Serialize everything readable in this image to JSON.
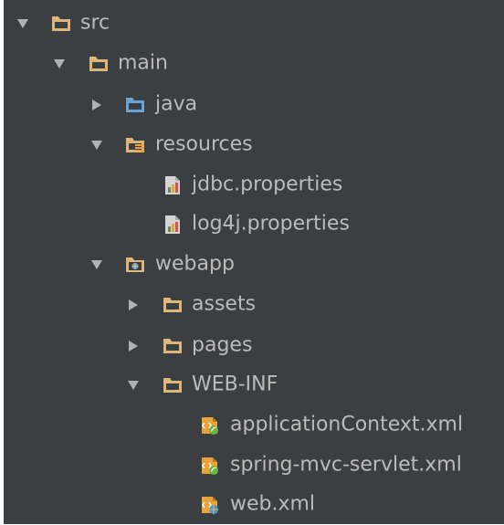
{
  "tree": {
    "items": [
      {
        "label": "src",
        "depth": 0,
        "state": "expanded",
        "icon": "folder-icon"
      },
      {
        "label": "main",
        "depth": 1,
        "state": "expanded",
        "icon": "folder-icon"
      },
      {
        "label": "java",
        "depth": 2,
        "state": "collapsed",
        "icon": "source-folder-icon"
      },
      {
        "label": "resources",
        "depth": 2,
        "state": "expanded",
        "icon": "resources-folder-icon"
      },
      {
        "label": "jdbc.properties",
        "depth": 3,
        "state": "leaf",
        "icon": "properties-file-icon"
      },
      {
        "label": "log4j.properties",
        "depth": 3,
        "state": "leaf",
        "icon": "properties-file-icon"
      },
      {
        "label": "webapp",
        "depth": 2,
        "state": "expanded",
        "icon": "web-folder-icon"
      },
      {
        "label": "assets",
        "depth": 3,
        "state": "collapsed",
        "icon": "folder-icon"
      },
      {
        "label": "pages",
        "depth": 3,
        "state": "collapsed",
        "icon": "folder-icon"
      },
      {
        "label": "WEB-INF",
        "depth": 3,
        "state": "expanded",
        "icon": "folder-icon"
      },
      {
        "label": "applicationContext.xml",
        "depth": 4,
        "state": "leaf",
        "icon": "spring-xml-file-icon"
      },
      {
        "label": "spring-mvc-servlet.xml",
        "depth": 4,
        "state": "leaf",
        "icon": "spring-xml-file-icon"
      },
      {
        "label": "web.xml",
        "depth": 4,
        "state": "leaf",
        "icon": "web-xml-file-icon"
      }
    ]
  },
  "colors": {
    "background": "#3c3f41",
    "text": "#bbbbbb",
    "folder": "#dcb67a",
    "source_folder": "#6aa3d5",
    "arrow": "#afb1b3"
  }
}
